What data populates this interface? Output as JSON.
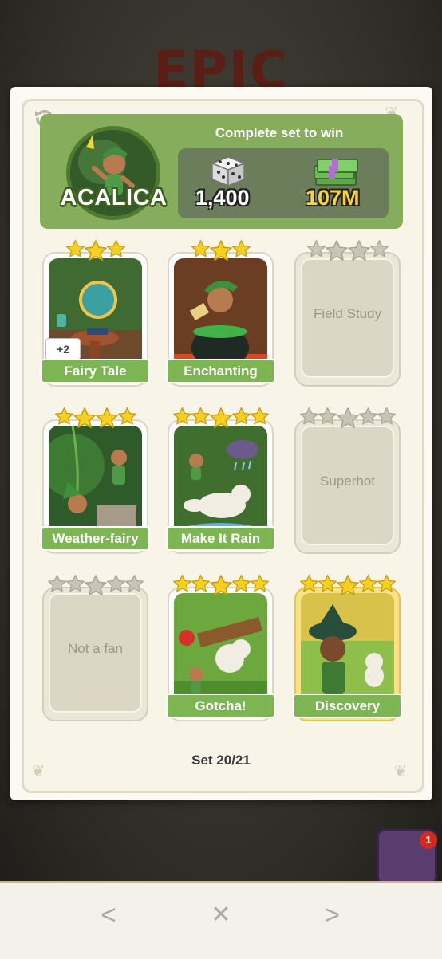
{
  "background_title": "EPIC",
  "album": {
    "name": "ACALICA",
    "reward_title": "Complete set to win",
    "rewards": [
      {
        "icon": "dice-icon",
        "value": "1,400"
      },
      {
        "icon": "cash-stack-icon",
        "value": "107M"
      }
    ],
    "set_progress": "Set 20/21"
  },
  "stickers": [
    {
      "name": "Fairy Tale",
      "stars": 3,
      "collected": true,
      "extra": "+2"
    },
    {
      "name": "Enchanting",
      "stars": 3,
      "collected": true
    },
    {
      "name": "Field Study",
      "stars": 4,
      "collected": false
    },
    {
      "name": "Weather-fairy",
      "stars": 4,
      "collected": true
    },
    {
      "name": "Make It Rain",
      "stars": 5,
      "collected": true
    },
    {
      "name": "Superhot",
      "stars": 5,
      "collected": false
    },
    {
      "name": "Not a fan",
      "stars": 5,
      "collected": false
    },
    {
      "name": "Gotcha!",
      "stars": 5,
      "collected": true
    },
    {
      "name": "Discovery",
      "stars": 5,
      "collected": true
    }
  ],
  "chest_badge": "1",
  "nav": {
    "prev": "<",
    "close": "✕",
    "next": ">"
  },
  "colors": {
    "header_green": "#86ad5c",
    "label_green": "#7db552",
    "star_gold": "#f5d020",
    "star_gray": "#c9c5b5"
  }
}
